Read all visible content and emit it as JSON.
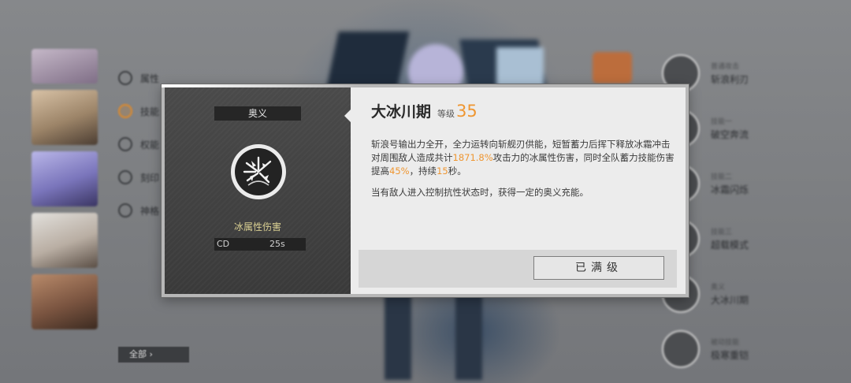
{
  "background": {
    "menu_items": [
      "属性",
      "技能",
      "权能",
      "刻印",
      "神格"
    ],
    "all_button": "全部",
    "skills": [
      {
        "tag": "普通攻击",
        "name": "斩浪利刃"
      },
      {
        "tag": "技能一",
        "name": "破空奔流"
      },
      {
        "tag": "技能二",
        "name": "冰霜闪烁"
      },
      {
        "tag": "技能三",
        "name": "超载模式"
      },
      {
        "tag": "奥义",
        "name": "大冰川期"
      },
      {
        "tag": "被动技能",
        "name": "极寒重铠"
      }
    ]
  },
  "dialog": {
    "category": "奥义",
    "damage_type": "冰属性伤害",
    "cd_label": "CD",
    "cd_value": "25s",
    "skill_name": "大冰川期",
    "level_label": "等级",
    "level_value": "35",
    "desc": {
      "p1_a": "斩浪号输出力全开，全力运转向斩舰刃供能，短暂蓄力后挥下释放冰霜冲击对周围敌人造成共计",
      "p1_hl1": "1871.8%",
      "p1_b": "攻击力的冰属性伤害，同时全队蓄力技能伤害提高",
      "p1_hl2": "45%",
      "p1_c": "，持续",
      "p1_hl3": "15",
      "p1_d": "秒。",
      "p2": "当有敌人进入控制抗性状态时，获得一定的奥义充能。"
    },
    "max_button": "已满级"
  },
  "colors": {
    "accent": "#ef9631",
    "damage_type": "#d9cf92"
  },
  "icons": [
    "ice-burst-skill-icon"
  ]
}
